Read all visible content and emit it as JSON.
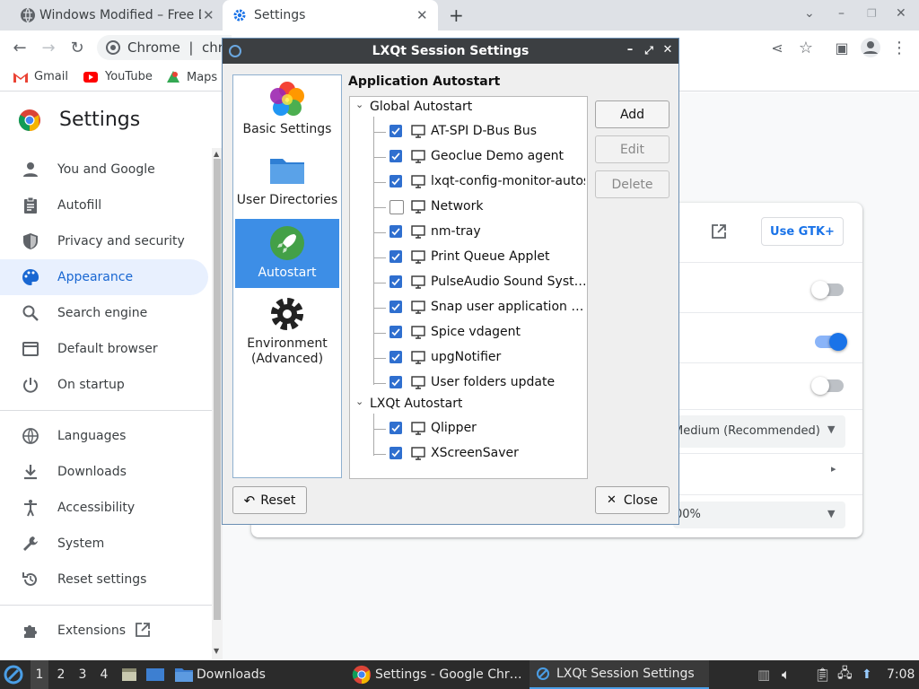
{
  "browser": {
    "tabs": [
      {
        "title": "Windows Modified – Free D",
        "active": false
      },
      {
        "title": "Settings",
        "active": true
      }
    ],
    "omnibox_text": "Chrome  |  chro",
    "bookmarks": [
      {
        "label": "Gmail",
        "icon": "gmail-icon"
      },
      {
        "label": "YouTube",
        "icon": "youtube-icon"
      },
      {
        "label": "Maps",
        "icon": "maps-icon"
      }
    ]
  },
  "settings": {
    "title": "Settings",
    "nav": [
      {
        "label": "You and Google",
        "icon": "person-icon"
      },
      {
        "label": "Autofill",
        "icon": "clipboard-icon"
      },
      {
        "label": "Privacy and security",
        "icon": "shield-icon"
      },
      {
        "label": "Appearance",
        "icon": "palette-icon",
        "selected": true
      },
      {
        "label": "Search engine",
        "icon": "search-icon"
      },
      {
        "label": "Default browser",
        "icon": "browser-icon"
      },
      {
        "label": "On startup",
        "icon": "power-icon"
      },
      {
        "label": "Languages",
        "icon": "globe-icon"
      },
      {
        "label": "Downloads",
        "icon": "download-icon"
      },
      {
        "label": "Accessibility",
        "icon": "accessibility-icon"
      },
      {
        "label": "System",
        "icon": "wrench-icon"
      },
      {
        "label": "Reset settings",
        "icon": "reset-icon"
      },
      {
        "label": "Extensions",
        "icon": "puzzle-icon"
      }
    ],
    "appearance": {
      "use_gtk_label": "Use GTK+",
      "font_size_value": "Medium (Recommended)",
      "page_zoom_value": "00%",
      "toggles": [
        false,
        true,
        false
      ]
    }
  },
  "dialog": {
    "title": "LXQt Session Settings",
    "categories": [
      {
        "label": "Basic Settings",
        "icon": "flower-icon"
      },
      {
        "label": "User Directories",
        "icon": "folder-icon"
      },
      {
        "label": "Autostart",
        "icon": "rocket-icon",
        "selected": true
      },
      {
        "label": "Environment\n(Advanced)",
        "icon": "cog-icon"
      }
    ],
    "section_title": "Application Autostart",
    "groups": [
      {
        "label": "Global Autostart",
        "items": [
          {
            "label": "AT-SPI D-Bus Bus",
            "checked": true
          },
          {
            "label": "Geoclue Demo agent",
            "checked": true
          },
          {
            "label": "lxqt-config-monitor-autos…",
            "checked": true
          },
          {
            "label": "Network",
            "checked": false
          },
          {
            "label": "nm-tray",
            "checked": true
          },
          {
            "label": "Print Queue Applet",
            "checked": true
          },
          {
            "label": "PulseAudio Sound Syst…",
            "checked": true
          },
          {
            "label": "Snap user application …",
            "checked": true
          },
          {
            "label": "Spice vdagent",
            "checked": true
          },
          {
            "label": "upgNotifier",
            "checked": true
          },
          {
            "label": "User folders update",
            "checked": true
          }
        ]
      },
      {
        "label": "LXQt Autostart",
        "items": [
          {
            "label": "Qlipper",
            "checked": true
          },
          {
            "label": "XScreenSaver",
            "checked": true
          }
        ]
      }
    ],
    "buttons": {
      "add": "Add",
      "edit": "Edit",
      "delete": "Delete",
      "reset": "Reset",
      "close": "Close"
    }
  },
  "taskbar": {
    "desktops": [
      "1",
      "2",
      "3",
      "4"
    ],
    "active_desktop": "1",
    "downloads_label": "Downloads",
    "windows": [
      {
        "label": "Settings - Google Chr…",
        "icon": "chrome-icon"
      },
      {
        "label": "LXQt Session Settings",
        "icon": "lxqt-icon",
        "active": true
      }
    ],
    "clock": "7:08"
  }
}
